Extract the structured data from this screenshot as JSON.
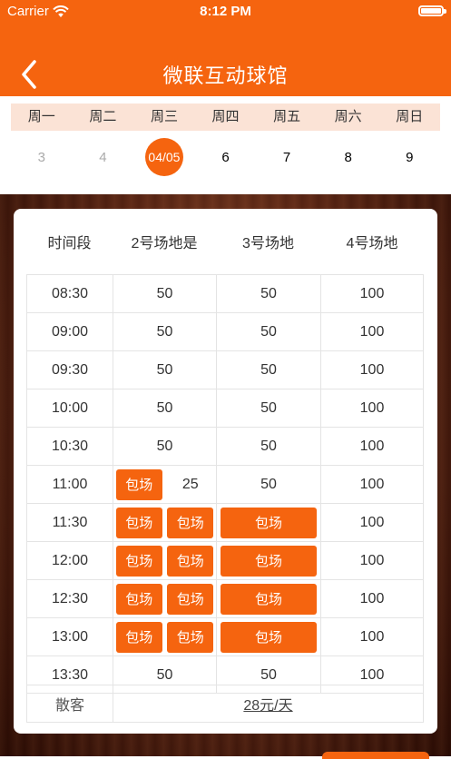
{
  "status": {
    "carrier": "Carrier",
    "time": "8:12 PM"
  },
  "nav": {
    "title": "微联互动球馆"
  },
  "week": {
    "days": [
      "周一",
      "周二",
      "周三",
      "周四",
      "周五",
      "周六",
      "周日"
    ],
    "dates": [
      "3",
      "4",
      "04/05",
      "6",
      "7",
      "8",
      "9"
    ],
    "selected_index": 2
  },
  "table": {
    "headers": [
      "时间段",
      "2号场地是",
      "3号场地",
      "4号场地"
    ],
    "booked_label": "包场",
    "rows": [
      {
        "time": "08:30",
        "c1": "50",
        "c2": "50",
        "c3": "100"
      },
      {
        "time": "09:00",
        "c1": "50",
        "c2": "50",
        "c3": "100"
      },
      {
        "time": "09:30",
        "c1": "50",
        "c2": "50",
        "c3": "100"
      },
      {
        "time": "10:00",
        "c1": "50",
        "c2": "50",
        "c3": "100"
      },
      {
        "time": "10:30",
        "c1": "50",
        "c2": "50",
        "c3": "100"
      },
      {
        "time": "11:00",
        "c1a": "包场",
        "c1b": "25",
        "c2": "50",
        "c3": "100"
      },
      {
        "time": "11:30",
        "c1a": "包场",
        "c1b": "包场",
        "c2": "包场",
        "c3": "100"
      },
      {
        "time": "12:00",
        "c1a": "包场",
        "c1b": "包场",
        "c2": "包场",
        "c3": "100"
      },
      {
        "time": "12:30",
        "c1a": "包场",
        "c1b": "包场",
        "c2": "包场",
        "c3": "100"
      },
      {
        "time": "13:00",
        "c1a": "包场",
        "c1b": "包场",
        "c2": "包场",
        "c3": "100"
      },
      {
        "time": "13:30",
        "c1": "50",
        "c2": "50",
        "c3": "100"
      }
    ],
    "footer": {
      "label": "散客",
      "price": "28元/天"
    }
  },
  "colors": {
    "accent": "#f5640f",
    "weekbar": "#fbe3d6"
  },
  "icons": {
    "back": "chevron-left-icon",
    "wifi": "wifi-icon",
    "battery": "battery-icon"
  }
}
